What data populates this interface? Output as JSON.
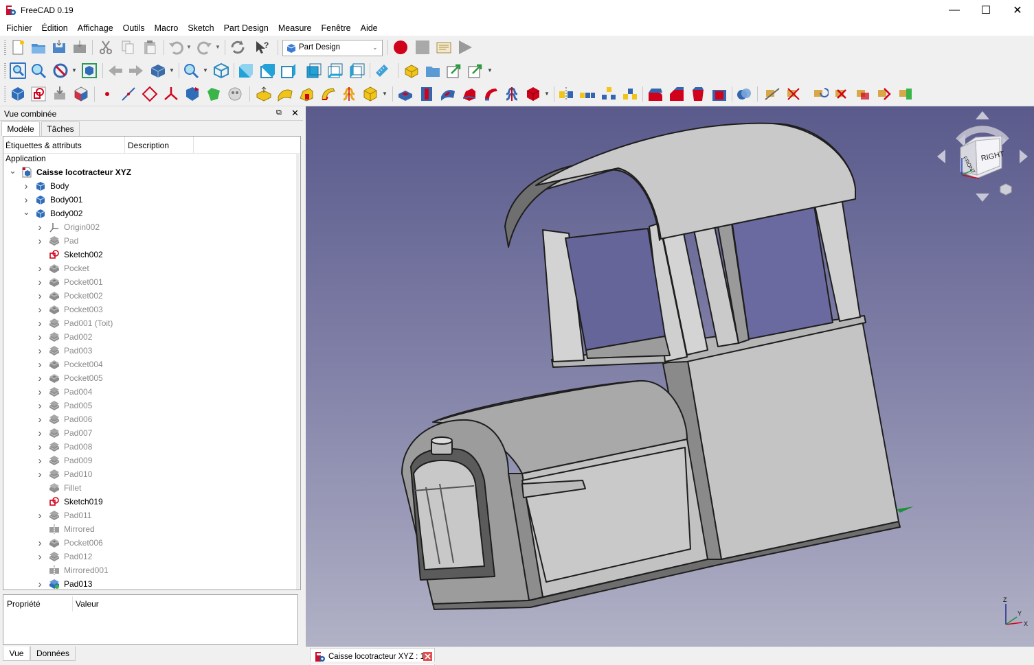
{
  "window": {
    "title": "FreeCAD 0.19",
    "controls": [
      "—",
      "☐",
      "✕"
    ]
  },
  "menu": [
    "Fichier",
    "Édition",
    "Affichage",
    "Outils",
    "Macro",
    "Sketch",
    "Part Design",
    "Measure",
    "Fenêtre",
    "Aide"
  ],
  "workbench_select": {
    "value": "Part Design"
  },
  "combo_view": {
    "title": "Vue combinée",
    "tabs": [
      "Modèle",
      "Tâches"
    ],
    "columns": [
      "Étiquettes & attributs",
      "Description"
    ],
    "section": "Application",
    "tree": [
      {
        "label": "Caisse locotracteur XYZ",
        "depth": 0,
        "expand": "open",
        "icon": "document-icon",
        "bold": true,
        "dim": false
      },
      {
        "label": "Body",
        "depth": 1,
        "expand": "closed",
        "icon": "body-icon",
        "dim": false
      },
      {
        "label": "Body001",
        "depth": 1,
        "expand": "closed",
        "icon": "body-icon",
        "dim": false
      },
      {
        "label": "Body002",
        "depth": 1,
        "expand": "open",
        "icon": "body-icon",
        "dim": false
      },
      {
        "label": "Origin002",
        "depth": 2,
        "expand": "closed",
        "icon": "origin-icon",
        "dim": true
      },
      {
        "label": "Pad",
        "depth": 2,
        "expand": "closed",
        "icon": "pad-icon",
        "dim": true
      },
      {
        "label": "Sketch002",
        "depth": 2,
        "expand": "none",
        "icon": "sketch-icon",
        "dim": false
      },
      {
        "label": "Pocket",
        "depth": 2,
        "expand": "closed",
        "icon": "pocket-icon",
        "dim": true
      },
      {
        "label": "Pocket001",
        "depth": 2,
        "expand": "closed",
        "icon": "pocket-icon",
        "dim": true
      },
      {
        "label": "Pocket002",
        "depth": 2,
        "expand": "closed",
        "icon": "pocket-icon",
        "dim": true
      },
      {
        "label": "Pocket003",
        "depth": 2,
        "expand": "closed",
        "icon": "pocket-icon",
        "dim": true
      },
      {
        "label": "Pad001 (Toit)",
        "depth": 2,
        "expand": "closed",
        "icon": "pad-icon",
        "dim": true
      },
      {
        "label": "Pad002",
        "depth": 2,
        "expand": "closed",
        "icon": "pad-icon",
        "dim": true
      },
      {
        "label": "Pad003",
        "depth": 2,
        "expand": "closed",
        "icon": "pad-icon",
        "dim": true
      },
      {
        "label": "Pocket004",
        "depth": 2,
        "expand": "closed",
        "icon": "pocket-icon",
        "dim": true
      },
      {
        "label": "Pocket005",
        "depth": 2,
        "expand": "closed",
        "icon": "pocket-icon",
        "dim": true
      },
      {
        "label": "Pad004",
        "depth": 2,
        "expand": "closed",
        "icon": "pad-icon",
        "dim": true
      },
      {
        "label": "Pad005",
        "depth": 2,
        "expand": "closed",
        "icon": "pad-icon",
        "dim": true
      },
      {
        "label": "Pad006",
        "depth": 2,
        "expand": "closed",
        "icon": "pad-icon",
        "dim": true
      },
      {
        "label": "Pad007",
        "depth": 2,
        "expand": "closed",
        "icon": "pad-icon",
        "dim": true
      },
      {
        "label": "Pad008",
        "depth": 2,
        "expand": "closed",
        "icon": "pad-icon",
        "dim": true
      },
      {
        "label": "Pad009",
        "depth": 2,
        "expand": "closed",
        "icon": "pad-icon",
        "dim": true
      },
      {
        "label": "Pad010",
        "depth": 2,
        "expand": "closed",
        "icon": "pad-icon",
        "dim": true
      },
      {
        "label": "Fillet",
        "depth": 2,
        "expand": "none",
        "icon": "fillet-icon",
        "dim": true
      },
      {
        "label": "Sketch019",
        "depth": 2,
        "expand": "none",
        "icon": "sketch-icon",
        "dim": false
      },
      {
        "label": "Pad011",
        "depth": 2,
        "expand": "closed",
        "icon": "pad-icon",
        "dim": true
      },
      {
        "label": "Mirrored",
        "depth": 2,
        "expand": "none",
        "icon": "mirrored-icon",
        "dim": true
      },
      {
        "label": "Pocket006",
        "depth": 2,
        "expand": "closed",
        "icon": "pocket-icon",
        "dim": true
      },
      {
        "label": "Pad012",
        "depth": 2,
        "expand": "closed",
        "icon": "pad-icon",
        "dim": true
      },
      {
        "label": "Mirrored001",
        "depth": 2,
        "expand": "none",
        "icon": "mirrored-icon",
        "dim": true
      },
      {
        "label": "Pad013",
        "depth": 2,
        "expand": "closed",
        "icon": "pad-tip-icon",
        "dim": false
      }
    ]
  },
  "properties": {
    "columns": [
      "Propriété",
      "Valeur"
    ],
    "tabs": [
      "Vue",
      "Données"
    ]
  },
  "document_tab": {
    "label": "Caisse locotracteur XYZ : 1"
  },
  "navcube": {
    "right_face": "RIGHT",
    "front_face": "FRONT"
  },
  "axis_labels": {
    "z": "Z",
    "x": "X",
    "y": "Y"
  },
  "colors": {
    "viewport_top": "#5a5a8c",
    "viewport_bottom": "#b1b1c6",
    "model_face": "#c8c8c8",
    "record": "#d0021b"
  }
}
